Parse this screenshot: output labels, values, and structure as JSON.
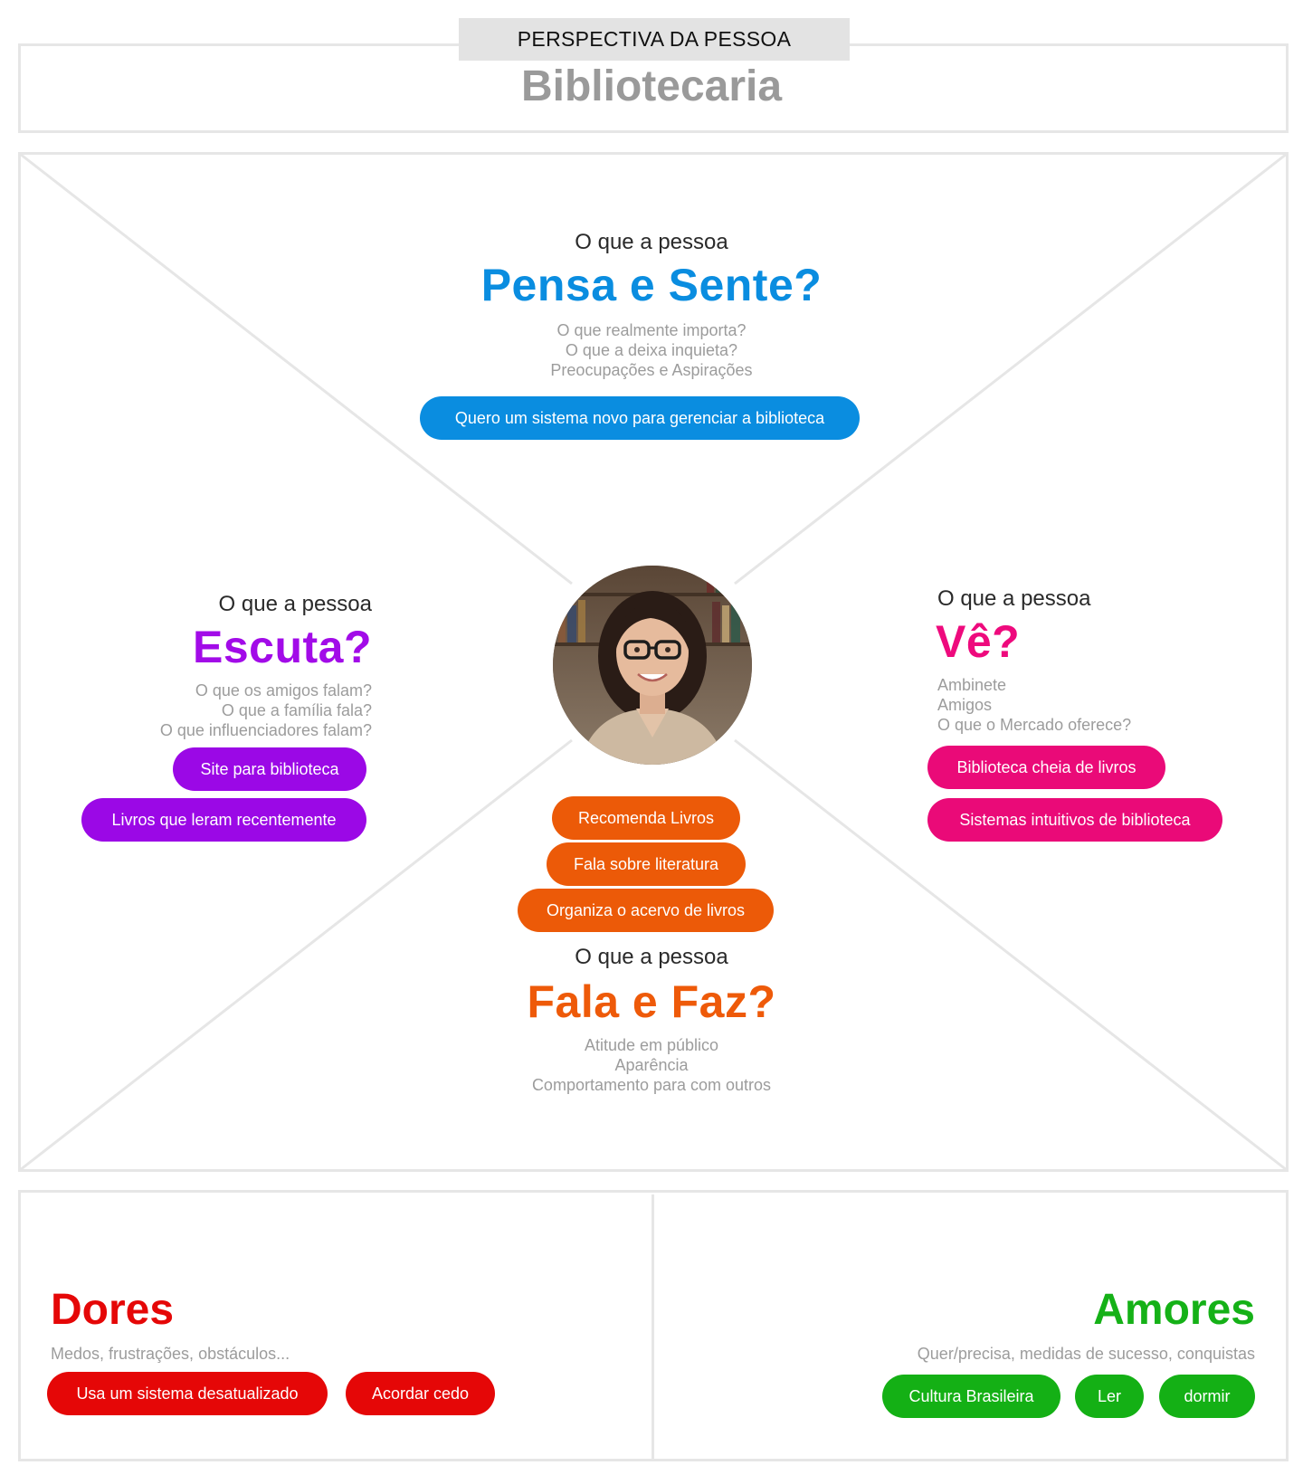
{
  "header": {
    "tag": "PERSPECTIVA DA PESSOA",
    "persona": "Bibliotecaria"
  },
  "colors": {
    "pensa": "#0a8de0",
    "escuta": "#a20be8",
    "ve": "#ee0a7d",
    "fala": "#ee5a09",
    "dores": "#e50707",
    "amores": "#15b117",
    "border": "#e6e6e6"
  },
  "pensa": {
    "intro": "O que a pessoa",
    "title": "Pensa e Sente?",
    "hints": [
      "O que realmente importa?",
      "O que a deixa inquieta?",
      "Preocupações e Aspirações"
    ],
    "notes": [
      "Quero um sistema novo para gerenciar a biblioteca"
    ]
  },
  "escuta": {
    "intro": "O que a pessoa",
    "title": "Escuta?",
    "hints": [
      "O que os amigos falam?",
      "O que a família fala?",
      "O que influenciadores falam?"
    ],
    "notes": [
      "Site para biblioteca",
      "Livros que leram recentemente"
    ]
  },
  "ve": {
    "intro": "O que a pessoa",
    "title": "Vê?",
    "hints": [
      "Ambinete",
      "Amigos",
      "O que o Mercado oferece?"
    ],
    "notes": [
      "Biblioteca cheia de livros",
      "Sistemas intuitivos de biblioteca"
    ]
  },
  "fala": {
    "notes": [
      "Recomenda Livros",
      "Fala sobre literatura",
      "Organiza o acervo de livros"
    ],
    "intro": "O que a pessoa",
    "title": "Fala e Faz?",
    "hints": [
      "Atitude em público",
      "Aparência",
      "Comportamento para com outros"
    ]
  },
  "avatar": {
    "icon": "person-photo"
  },
  "dores": {
    "title": "Dores",
    "subtitle": "Medos, frustrações, obstáculos...",
    "notes": [
      "Usa um sistema desatualizado",
      "Acordar cedo"
    ]
  },
  "amores": {
    "title": "Amores",
    "subtitle": "Quer/precisa, medidas de sucesso, conquistas",
    "notes": [
      "Cultura Brasileira",
      "Ler",
      "dormir"
    ]
  }
}
